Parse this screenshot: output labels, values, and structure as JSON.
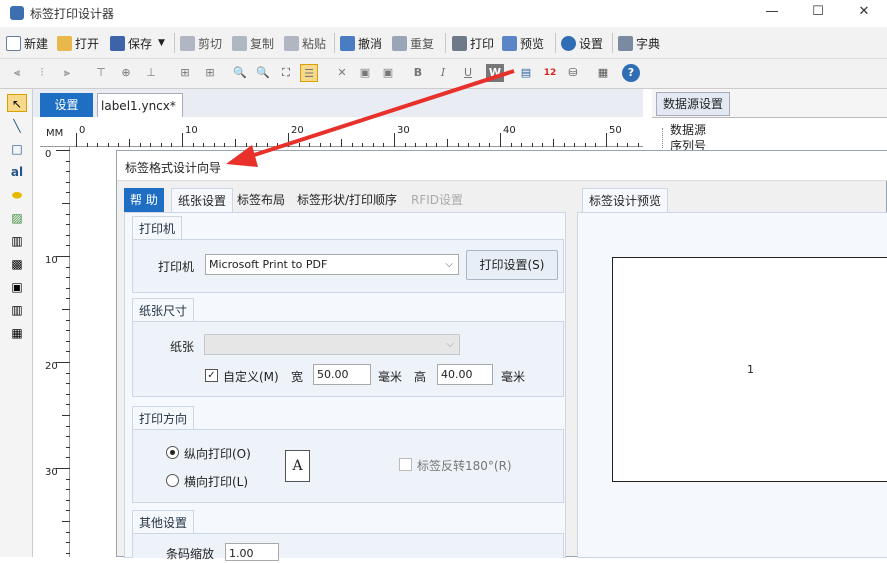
{
  "window": {
    "title": "标签打印设计器"
  },
  "toolbar1": [
    {
      "name": "new-button",
      "label": "新建",
      "icon": "new-file-icon"
    },
    {
      "name": "open-button",
      "label": "打开",
      "icon": "folder-icon"
    },
    {
      "name": "save-button",
      "label": "保存",
      "icon": "floppy-icon"
    },
    {
      "name": "cut-button",
      "label": "剪切",
      "icon": "scissors-icon"
    },
    {
      "name": "copy-button",
      "label": "复制",
      "icon": "copy-icon"
    },
    {
      "name": "paste-button",
      "label": "粘贴",
      "icon": "paste-icon"
    },
    {
      "name": "undo-button",
      "label": "撤消",
      "icon": "undo-icon"
    },
    {
      "name": "redo-button",
      "label": "重复",
      "icon": "redo-icon"
    },
    {
      "name": "print-button",
      "label": "打印",
      "icon": "printer-icon"
    },
    {
      "name": "preview-button",
      "label": "预览",
      "icon": "magnifier-icon"
    },
    {
      "name": "settings-button",
      "label": "设置",
      "icon": "gear-icon"
    },
    {
      "name": "dictionary-button",
      "label": "字典",
      "icon": "book-icon"
    }
  ],
  "tabs": {
    "settings": "设置",
    "file": "label1.yncx*",
    "close": "×"
  },
  "ruler": {
    "unit": "MM",
    "top_labels": [
      "0",
      "10",
      "20",
      "30",
      "40",
      "50"
    ],
    "left_labels": [
      "0",
      "10",
      "20",
      "30"
    ]
  },
  "right_panel": {
    "title": "数据源设置",
    "tree": [
      "数据源",
      "序列号"
    ]
  },
  "dialog": {
    "title": "标签格式设计向导",
    "tabs": [
      "帮 助",
      "纸张设置",
      "标签布局",
      "标签形状/打印顺序",
      "RFID设置"
    ],
    "preview_tab": "标签设计预览",
    "preview_number": "1",
    "printer_group": {
      "title": "打印机",
      "label": "打印机",
      "value": "Microsoft Print to PDF",
      "button": "打印设置(S)"
    },
    "paper_group": {
      "title": "纸张尺寸",
      "paper_label": "纸张",
      "custom_label": "自定义(M)",
      "width_label": "宽",
      "width_value": "50.00",
      "height_label": "高",
      "height_value": "40.00",
      "unit": "毫米"
    },
    "orientation_group": {
      "title": "打印方向",
      "portrait": "纵向打印(O)",
      "landscape": "横向打印(L)",
      "reverse": "标签反转180°(R)",
      "sample": "A"
    },
    "other_group": {
      "title": "其他设置",
      "barcode_label": "条码缩放",
      "barcode_value": "1.00"
    }
  },
  "colors": {
    "accent": "#1e6fc4",
    "arrow": "#e8312a"
  }
}
